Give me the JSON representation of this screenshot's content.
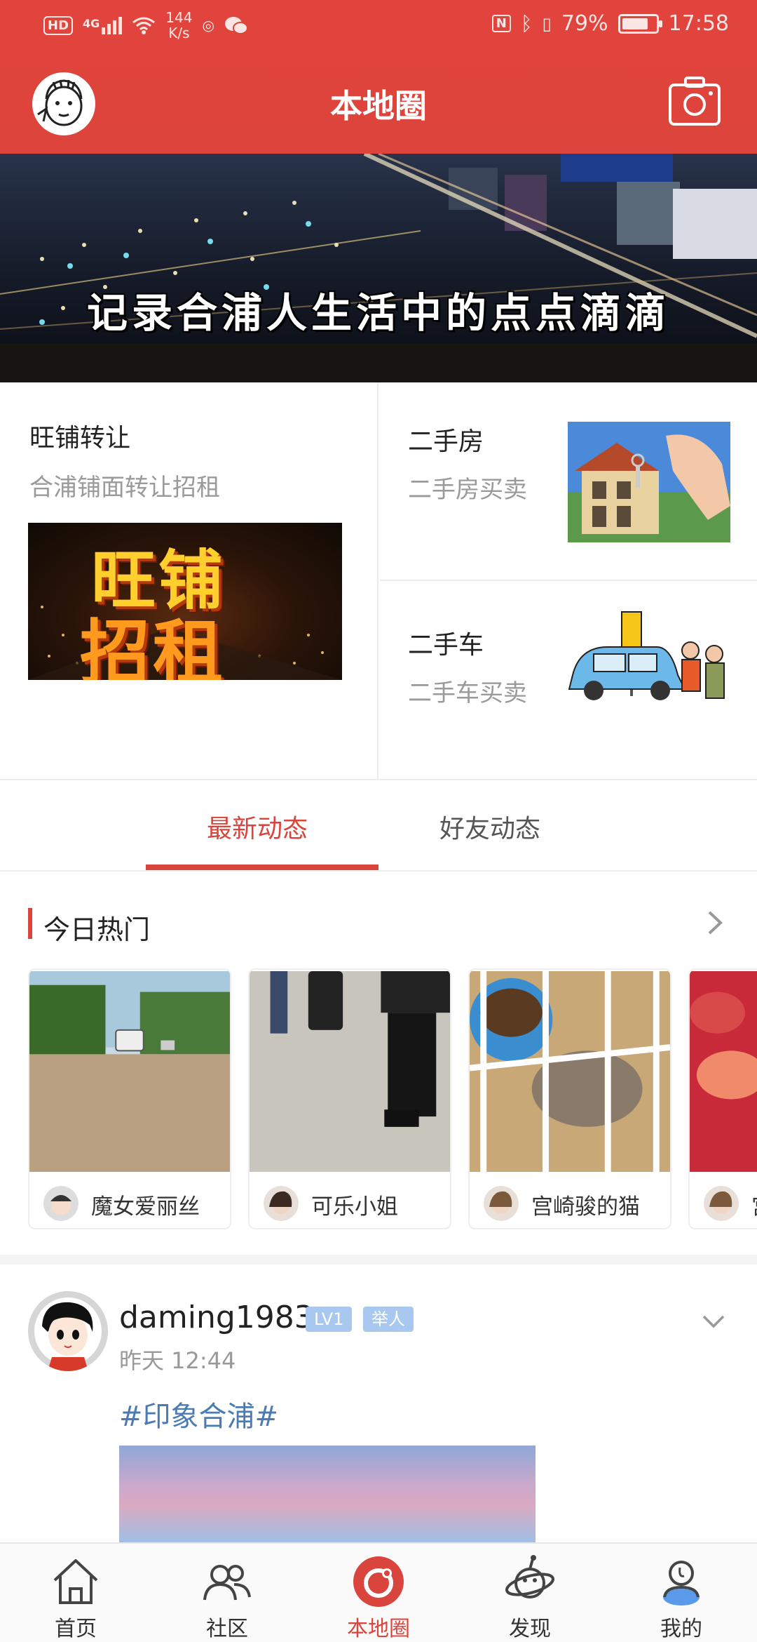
{
  "status_bar": {
    "hd": "HD",
    "network": "4G",
    "speed_value": "144",
    "speed_unit": "K/s",
    "battery_percent": "79%",
    "battery_level": 0.79,
    "time": "17:58"
  },
  "header": {
    "title": "本地圈",
    "accent_color": "#dc443c"
  },
  "banner": {
    "caption": "记录合浦人生活中的点点滴滴"
  },
  "categories": {
    "shop": {
      "title": "旺铺转让",
      "subtitle": "合浦铺面转让招租",
      "image_text_1": "旺铺",
      "image_text_2": "招租"
    },
    "house": {
      "title": "二手房",
      "subtitle": "二手房买卖"
    },
    "car": {
      "title": "二手车",
      "subtitle": "二手车买卖"
    }
  },
  "tabs": [
    {
      "label": "最新动态",
      "active": true
    },
    {
      "label": "好友动态",
      "active": false
    }
  ],
  "hot": {
    "title": "今日热门",
    "items": [
      {
        "user": "魔女爱丽丝"
      },
      {
        "user": "可乐小姐"
      },
      {
        "user": "宫崎骏的猫"
      },
      {
        "user": "宫"
      }
    ]
  },
  "post": {
    "username": "daming1983",
    "level_badge": "LV1",
    "title_badge": "举人",
    "time": "昨天 12:44",
    "tag": "#印象合浦#"
  },
  "bottom_nav": [
    {
      "label": "首页",
      "icon": "home-icon"
    },
    {
      "label": "社区",
      "icon": "community-icon"
    },
    {
      "label": "本地圈",
      "icon": "local-circle-icon",
      "active": true
    },
    {
      "label": "发现",
      "icon": "discover-icon"
    },
    {
      "label": "我的",
      "icon": "profile-icon"
    }
  ]
}
